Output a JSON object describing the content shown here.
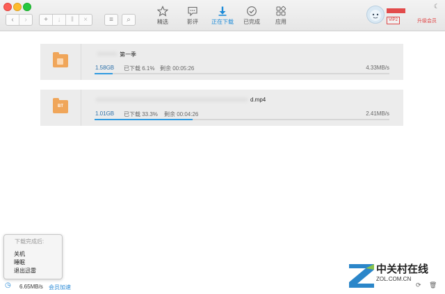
{
  "toolbar": {
    "nav_buttons": [
      "‹",
      "›"
    ],
    "action_buttons": [
      "+",
      "↓",
      "‖",
      "×",
      "≡",
      "⌕"
    ],
    "tabs": [
      {
        "label": "精选",
        "icon": "star-icon"
      },
      {
        "label": "影评",
        "icon": "comment-icon"
      },
      {
        "label": "正在下载",
        "icon": "download-icon",
        "active": true
      },
      {
        "label": "已完成",
        "icon": "check-icon"
      },
      {
        "label": "应用",
        "icon": "apps-icon"
      }
    ],
    "vip_badge": "VIP2",
    "upgrade_label": "升级会员",
    "accent_color": "#1a8ad8"
  },
  "tasks": [
    {
      "name": "第一季",
      "size": "1.58GB",
      "progress_label": "已下载 6.1%",
      "progress": 0.061,
      "remaining": "剩余 00:05:26",
      "speed": "4.33MB/s",
      "icon": "folder-icon"
    },
    {
      "name": "d.mp4",
      "size": "1.01GB",
      "progress_label": "已下载 33.3%",
      "progress": 0.333,
      "remaining": "剩余 00:04:26",
      "speed": "2.41MB/s",
      "icon": "bt-folder-icon",
      "badge": "BT"
    }
  ],
  "popup": {
    "title": "下载完成后:",
    "items": [
      "关机",
      "睡眠",
      "退出迅雷"
    ]
  },
  "status": {
    "speed": "6.65MB/s",
    "vip_boost": "会员加速"
  },
  "watermark": {
    "cn": "中关村在线",
    "en": "ZOL.COM.CN"
  }
}
